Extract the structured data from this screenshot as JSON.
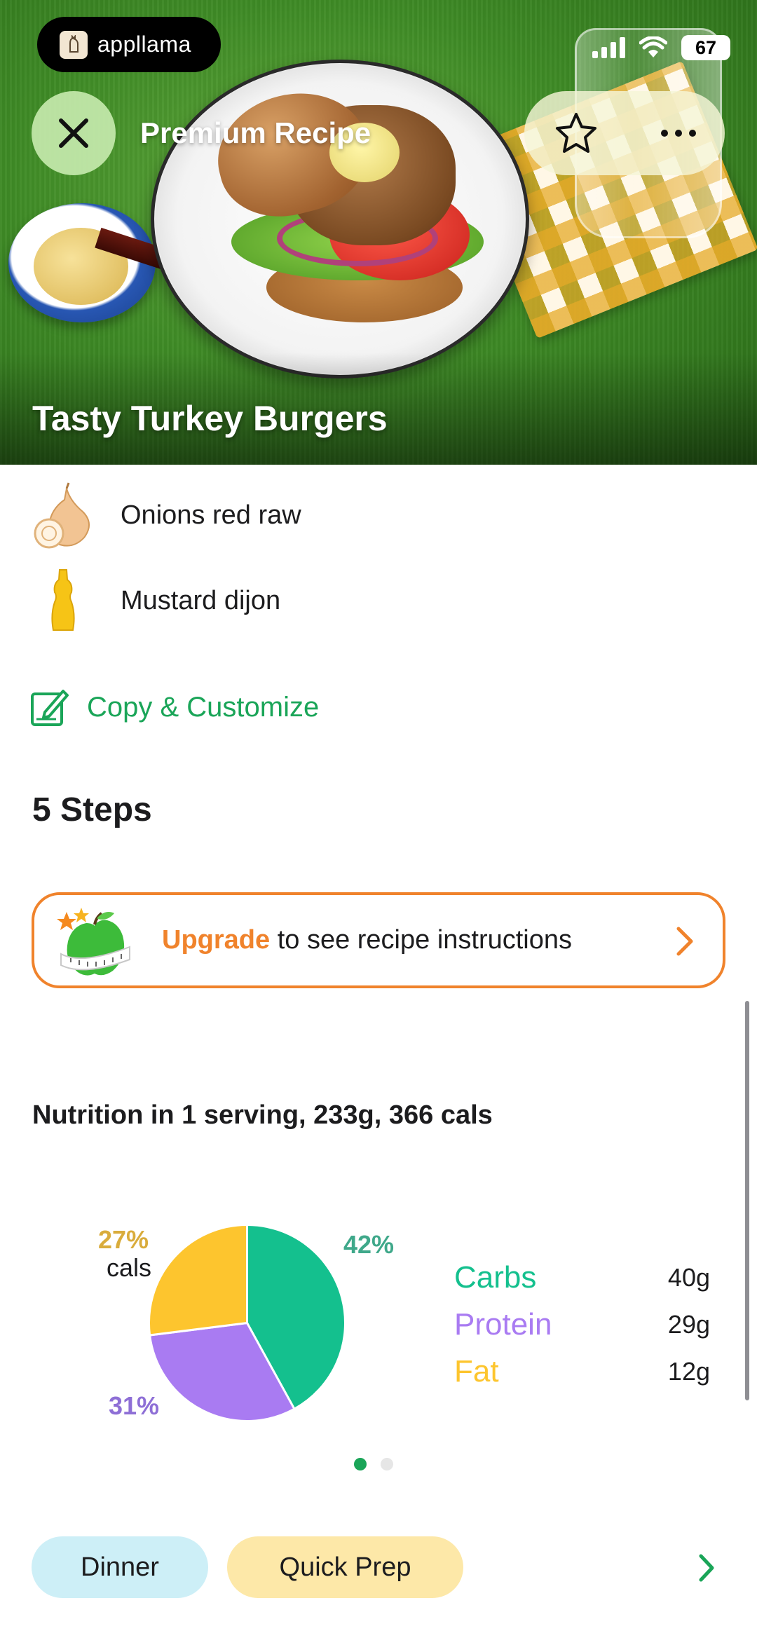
{
  "status_bar": {
    "app_name": "appllama",
    "battery": "67"
  },
  "nav": {
    "title": "Premium Recipe"
  },
  "recipe": {
    "title": "Tasty Turkey Burgers"
  },
  "ingredients": [
    {
      "name": "Onions red raw",
      "icon": "onion-icon"
    },
    {
      "name": "Mustard dijon",
      "icon": "mustard-bottle-icon"
    }
  ],
  "copy_customize": {
    "label": "Copy & Customize",
    "icon": "edit-icon"
  },
  "steps": {
    "title": "5 Steps"
  },
  "upgrade": {
    "highlight": "Upgrade",
    "text": " to see recipe instructions"
  },
  "nutrition": {
    "title": "Nutrition in 1 serving, 233g, 366 cals",
    "cals_label": "cals",
    "macros": [
      {
        "name": "Carbs",
        "value": "40g",
        "percent_label": "42%",
        "color": "#14c08e"
      },
      {
        "name": "Protein",
        "value": "29g",
        "percent_label": "31%",
        "color": "#a97bf2"
      },
      {
        "name": "Fat",
        "value": "12g",
        "percent_label": "27%",
        "color": "#fdc52e"
      }
    ]
  },
  "chart_data": {
    "type": "pie",
    "labels": [
      "Carbs",
      "Protein",
      "Fat"
    ],
    "values": [
      42,
      31,
      27
    ],
    "colors": [
      "#14c08e",
      "#a97bf2",
      "#fdc52e"
    ]
  },
  "pager": {
    "count": 2,
    "active": 0
  },
  "tags": [
    {
      "label": "Dinner",
      "color": "#cdeff7"
    },
    {
      "label": "Quick Prep",
      "color": "#fde8a8"
    }
  ],
  "colors": {
    "accent_green": "#1aa558",
    "upgrade_orange": "#f0832c"
  }
}
